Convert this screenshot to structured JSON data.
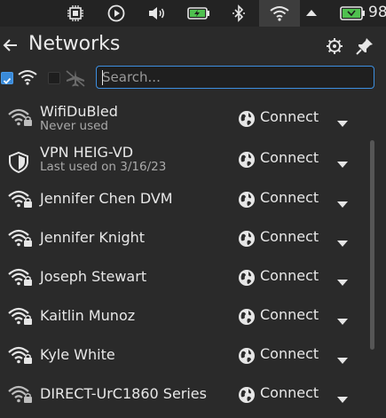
{
  "tray": {
    "icons": [
      "cpu-icon",
      "media-play-icon",
      "volume-icon",
      "battery-charging-icon",
      "bluetooth-icon",
      "wifi-icon",
      "chevron-up-icon",
      "battery-icon"
    ],
    "battery_percent": "98"
  },
  "header": {
    "title": "Networks",
    "back_icon": "arrow-left-icon",
    "settings_icon": "gear-icon",
    "pin_icon": "pin-icon"
  },
  "filters": {
    "wifi_checked": true,
    "airplane_checked": false,
    "search_placeholder": "Search..."
  },
  "colors": {
    "accent": "#3d8fe0",
    "background": "#2a2a2a",
    "topbar": "#232323"
  },
  "networks": [
    {
      "name": "WifiDuBled",
      "sub": "Never used",
      "icon": "wifi-locked-icon",
      "action": "Connect"
    },
    {
      "name": "VPN HEIG-VD",
      "sub": "Last used on 3/16/23",
      "icon": "shield-icon",
      "action": "Connect"
    },
    {
      "name": "Jennifer Chen DVM",
      "sub": "",
      "icon": "wifi-locked-icon",
      "action": "Connect"
    },
    {
      "name": "Jennifer Knight",
      "sub": "",
      "icon": "wifi-locked-icon",
      "action": "Connect"
    },
    {
      "name": "Joseph Stewart",
      "sub": "",
      "icon": "wifi-locked-icon",
      "action": "Connect"
    },
    {
      "name": "Kaitlin Munoz",
      "sub": "",
      "icon": "wifi-locked-icon",
      "action": "Connect"
    },
    {
      "name": "Kyle White",
      "sub": "",
      "icon": "wifi-locked-icon",
      "action": "Connect"
    },
    {
      "name": "DIRECT-UrC1860 Series",
      "sub": "",
      "icon": "wifi-locked-icon",
      "action": "Connect"
    }
  ]
}
